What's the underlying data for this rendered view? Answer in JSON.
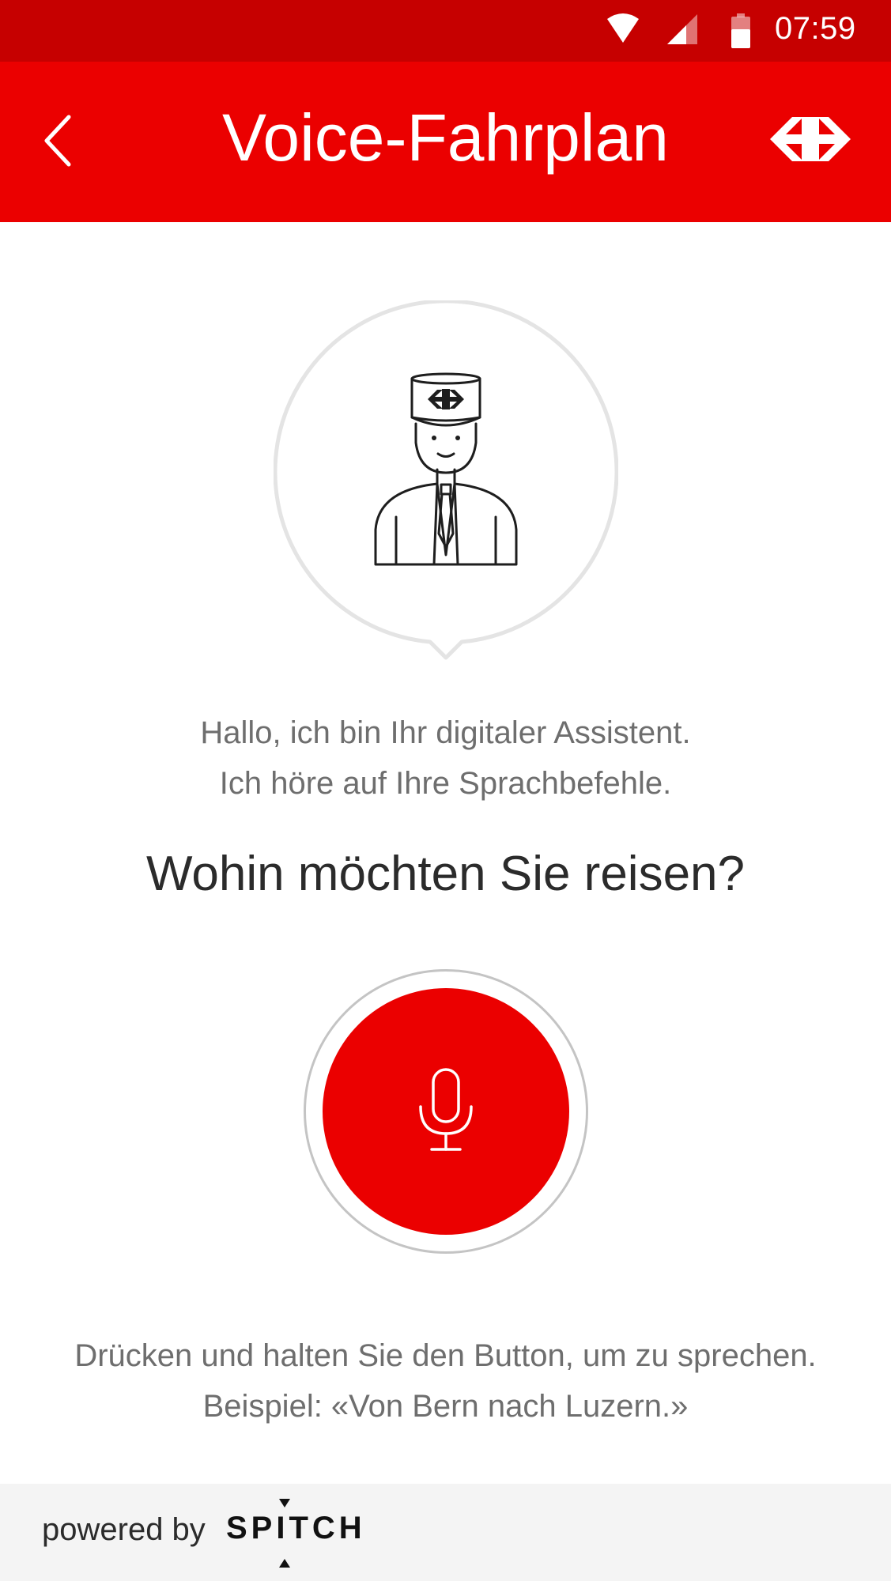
{
  "status_bar": {
    "time": "07:59",
    "icons": [
      "wifi-icon",
      "cellular-signal-icon",
      "battery-icon"
    ]
  },
  "header": {
    "back_icon": "chevron-left-icon",
    "title": "Voice-Fahrplan",
    "logo_icon": "sbb-logo-icon"
  },
  "assistant": {
    "avatar_icon": "conductor-icon",
    "greeting_line1": "Hallo, ich bin Ihr digitaler Assistent.",
    "greeting_line2": "Ich höre auf Ihre Sprachbefehle.",
    "question": "Wohin möchten Sie reisen?"
  },
  "mic": {
    "icon": "microphone-icon"
  },
  "hint": {
    "line1": "Drücken und halten Sie den Button, um zu sprechen.",
    "line2": "Beispiel: «Von Bern nach Luzern.»"
  },
  "footer": {
    "powered_by": "powered by",
    "brand": "SPITCH"
  },
  "colors": {
    "status_bar": "#c60000",
    "app_bar": "#eb0000",
    "mic_button": "#eb0000",
    "footer_bg": "#f4f4f4"
  }
}
